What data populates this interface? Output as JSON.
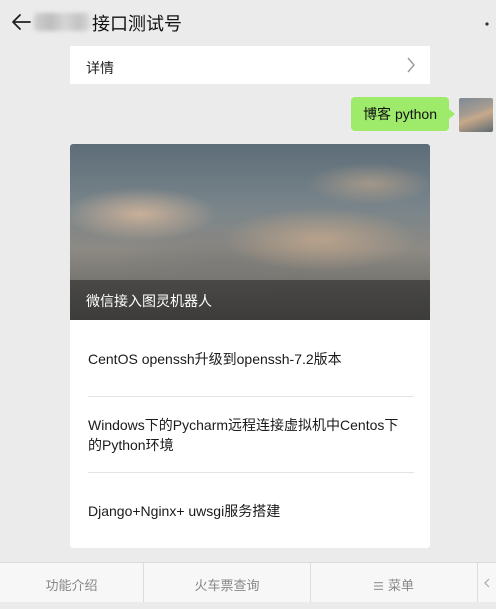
{
  "header": {
    "title": "接口测试号",
    "icons": {
      "back": "back-arrow-icon",
      "more": "more-dots-icon"
    }
  },
  "detail": {
    "label": "详情",
    "icon": "chevron-right-icon"
  },
  "chat": {
    "sent_message": "博客 python"
  },
  "news": {
    "cover_title": "微信接入图灵机器人",
    "articles": [
      {
        "title": "CentOS openssh升级到openssh-7.2版本"
      },
      {
        "title_line1": "Windows下的Pycharm远程连接虚拟机中Centos下",
        "title_line2": "的Python环境"
      },
      {
        "title": "Django+Nginx+ uwsgi服务搭建"
      }
    ]
  },
  "menu": {
    "items": [
      {
        "label": "功能介绍"
      },
      {
        "label": "火车票查询"
      },
      {
        "label": "菜单",
        "icon": "list-icon"
      }
    ]
  },
  "colors": {
    "bubble": "#9eea6a",
    "background": "#ebebeb"
  }
}
